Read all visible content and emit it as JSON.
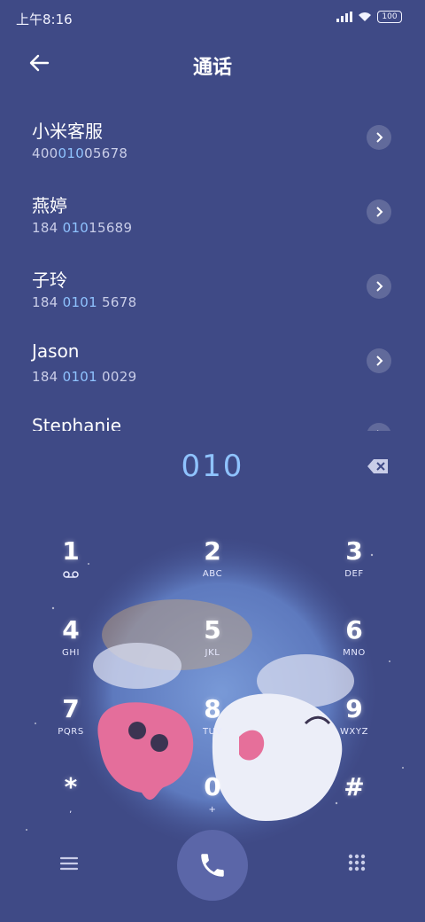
{
  "status_bar": {
    "time": "上午8:16",
    "battery": "100"
  },
  "header": {
    "title": "通话",
    "back_icon": "arrow-left-icon"
  },
  "contacts": [
    {
      "name": "小米客服",
      "number_pre": "400",
      "number_hl": "010",
      "number_post": "05678"
    },
    {
      "name": "燕婷",
      "number_pre": "184 ",
      "number_hl": "010",
      "number_post": "15689"
    },
    {
      "name": "子玲",
      "number_pre": "184 ",
      "number_hl": "0101",
      "number_post": " 5678"
    },
    {
      "name": "Jason",
      "number_pre": "184 ",
      "number_hl": "0101",
      "number_post": " 0029"
    },
    {
      "name": "Stephanie",
      "number_pre": "",
      "number_hl": "",
      "number_post": ""
    }
  ],
  "dialer": {
    "input": "010",
    "delete_icon": "backspace-icon"
  },
  "keypad": [
    {
      "num": "1",
      "sub": ""
    },
    {
      "num": "2",
      "sub": "ABC"
    },
    {
      "num": "3",
      "sub": "DEF"
    },
    {
      "num": "4",
      "sub": "GHI"
    },
    {
      "num": "5",
      "sub": "JKL"
    },
    {
      "num": "6",
      "sub": "MNO"
    },
    {
      "num": "7",
      "sub": "PQRS"
    },
    {
      "num": "8",
      "sub": "TUV"
    },
    {
      "num": "9",
      "sub": "WXYZ"
    },
    {
      "num": "*",
      "sub": ","
    },
    {
      "num": "0",
      "sub": "+"
    },
    {
      "num": "#",
      "sub": ""
    }
  ],
  "bottom_bar": {
    "menu_icon": "menu-icon",
    "call_icon": "phone-icon",
    "dialpad_icon": "dialpad-icon"
  },
  "colors": {
    "background": "#3f4a86",
    "highlight": "#8fc3ff",
    "call_button": "#5b66a8"
  }
}
